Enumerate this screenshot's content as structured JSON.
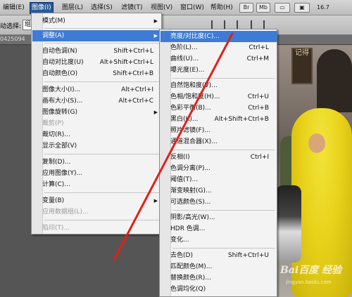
{
  "menubar": {
    "items": [
      {
        "label": "编辑(E)",
        "active": false
      },
      {
        "label": "图像(I)",
        "active": true
      },
      {
        "label": "图层(L)",
        "active": false
      },
      {
        "label": "选择(S)",
        "active": false
      },
      {
        "label": "滤镜(T)",
        "active": false
      },
      {
        "label": "视图(V)",
        "active": false
      },
      {
        "label": "窗口(W)",
        "active": false
      },
      {
        "label": "帮助(H)",
        "active": false
      }
    ],
    "br_label": "Br",
    "mb_label": "Mb",
    "zoom": "16.7"
  },
  "options": {
    "auto_select_label": "动选择:",
    "auto_select_value": "组"
  },
  "doc": {
    "tab_text": "0425094"
  },
  "image_menu": {
    "items": [
      {
        "label": "模式(M)",
        "shortcut": "",
        "submenu": true,
        "disabled": false
      },
      {
        "label": "调整(A)",
        "shortcut": "",
        "submenu": true,
        "disabled": false,
        "highlight": true
      },
      {
        "label": "自动色调(N)",
        "shortcut": "Shift+Ctrl+L",
        "disabled": false
      },
      {
        "label": "自动对比度(U)",
        "shortcut": "Alt+Shift+Ctrl+L",
        "disabled": false
      },
      {
        "label": "自动颜色(O)",
        "shortcut": "Shift+Ctrl+B",
        "disabled": false
      },
      {
        "label": "图像大小(I)...",
        "shortcut": "Alt+Ctrl+I",
        "disabled": false
      },
      {
        "label": "画布大小(S)...",
        "shortcut": "Alt+Ctrl+C",
        "disabled": false
      },
      {
        "label": "图像旋转(G)",
        "shortcut": "",
        "submenu": true,
        "disabled": false
      },
      {
        "label": "裁剪(P)",
        "shortcut": "",
        "disabled": true
      },
      {
        "label": "裁切(R)...",
        "shortcut": "",
        "disabled": false
      },
      {
        "label": "显示全部(V)",
        "shortcut": "",
        "disabled": false
      },
      {
        "label": "复制(D)...",
        "shortcut": "",
        "disabled": false
      },
      {
        "label": "应用图像(Y)...",
        "shortcut": "",
        "disabled": false
      },
      {
        "label": "计算(C)...",
        "shortcut": "",
        "disabled": false
      },
      {
        "label": "变量(B)",
        "shortcut": "",
        "submenu": true,
        "disabled": false
      },
      {
        "label": "应用数据组(L)...",
        "shortcut": "",
        "disabled": true
      },
      {
        "label": "陷印(T)...",
        "shortcut": "",
        "disabled": true
      }
    ]
  },
  "adjust_menu": {
    "items": [
      {
        "label": "亮度/对比度(C)...",
        "shortcut": "",
        "highlight": true
      },
      {
        "label": "色阶(L)...",
        "shortcut": "Ctrl+L"
      },
      {
        "label": "曲线(U)...",
        "shortcut": "Ctrl+M"
      },
      {
        "label": "曝光度(E)...",
        "shortcut": ""
      },
      {
        "label": "自然饱和度(V)...",
        "shortcut": ""
      },
      {
        "label": "色相/饱和度(H)...",
        "shortcut": "Ctrl+U"
      },
      {
        "label": "色彩平衡(B)...",
        "shortcut": "Ctrl+B"
      },
      {
        "label": "黑白(K)...",
        "shortcut": "Alt+Shift+Ctrl+B"
      },
      {
        "label": "照片滤镜(F)...",
        "shortcut": ""
      },
      {
        "label": "通道混合器(X)...",
        "shortcut": ""
      },
      {
        "label": "反相(I)",
        "shortcut": "Ctrl+I"
      },
      {
        "label": "色调分离(P)...",
        "shortcut": ""
      },
      {
        "label": "阈值(T)...",
        "shortcut": ""
      },
      {
        "label": "渐变映射(G)...",
        "shortcut": ""
      },
      {
        "label": "可选颜色(S)...",
        "shortcut": ""
      },
      {
        "label": "阴影/高光(W)...",
        "shortcut": ""
      },
      {
        "label": "HDR 色调...",
        "shortcut": ""
      },
      {
        "label": "变化...",
        "shortcut": ""
      },
      {
        "label": "去色(D)",
        "shortcut": "Shift+Ctrl+U"
      },
      {
        "label": "匹配颜色(M)...",
        "shortcut": ""
      },
      {
        "label": "替换颜色(R)...",
        "shortcut": ""
      },
      {
        "label": "色调均化(Q)",
        "shortcut": ""
      }
    ]
  },
  "photo": {
    "sign_text": "记得",
    "watermark": "Bai百度 经验",
    "watermark_url": "jingyan.baidu.com"
  },
  "colors": {
    "highlight": "#3f7bd4",
    "active_menu": "#2a5a97",
    "arrow": "#e0201a"
  }
}
